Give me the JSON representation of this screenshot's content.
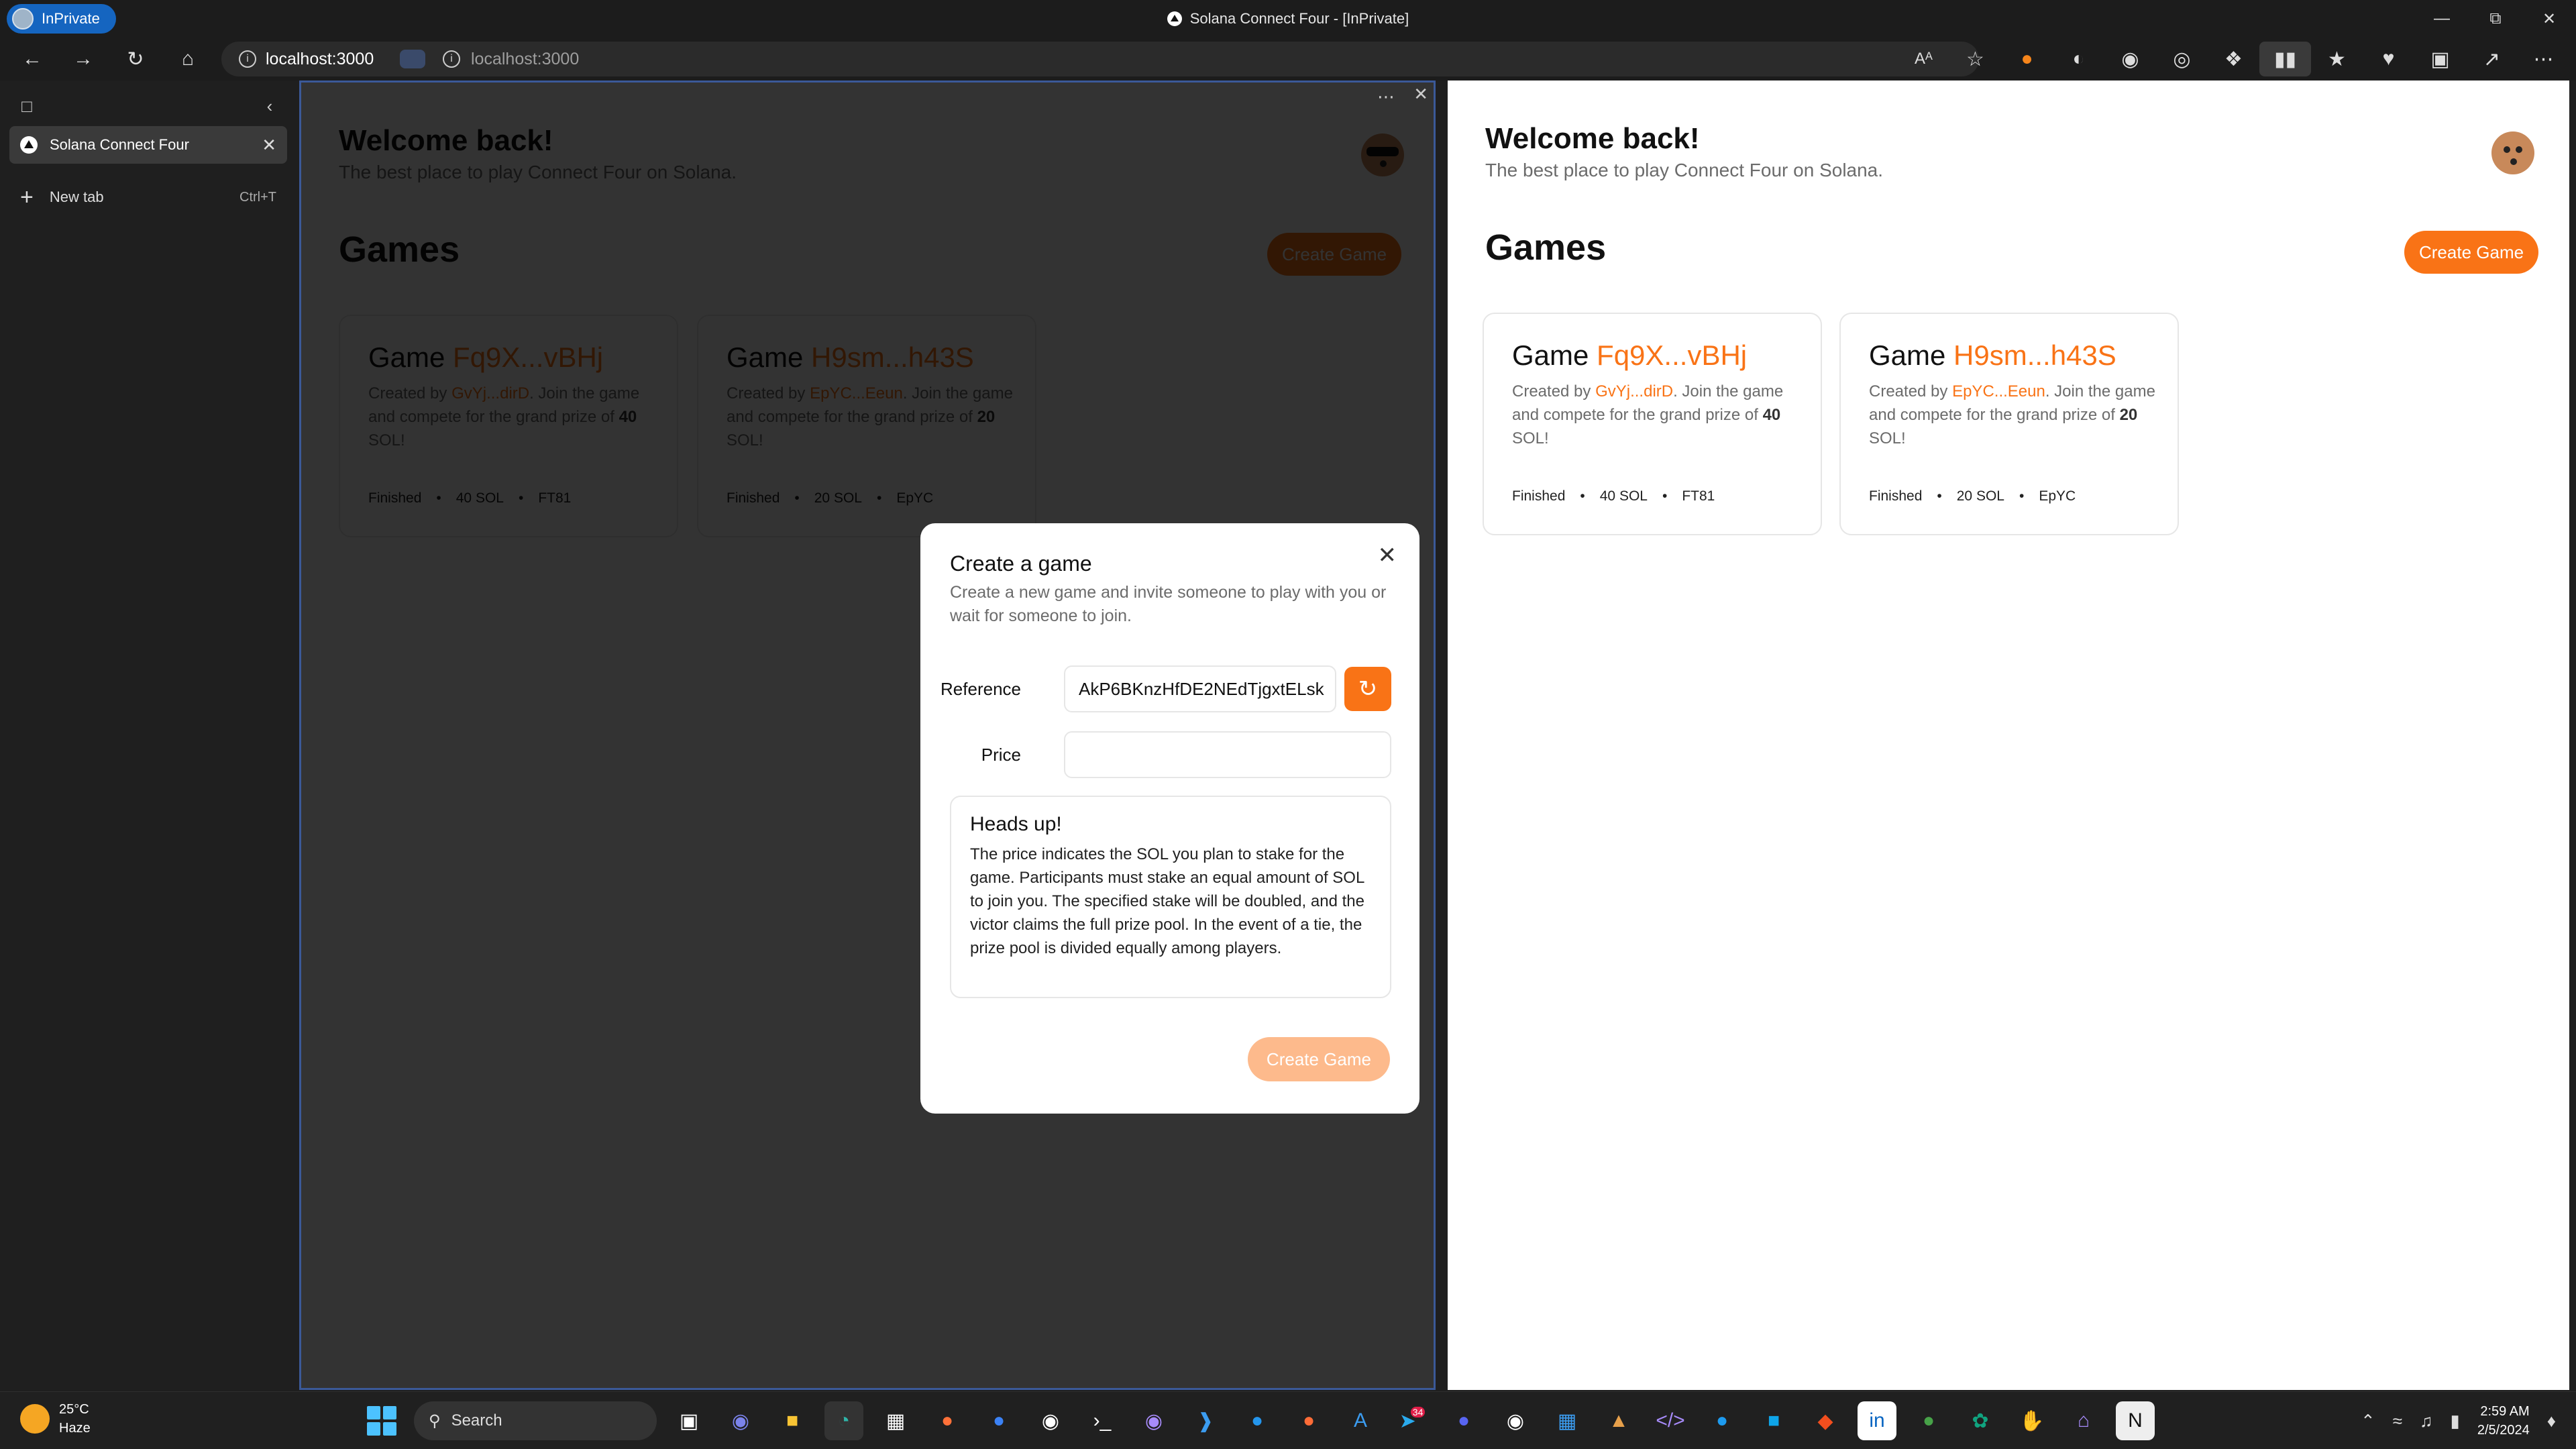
{
  "browser": {
    "profile_label": "InPrivate",
    "window_title": "Solana Connect Four - [InPrivate]",
    "url_primary": "localhost:3000",
    "url_secondary": "localhost:3000",
    "read_aloud_label": "Aᴬ"
  },
  "sidebar": {
    "tabs": [
      {
        "label": "Solana Connect Four"
      }
    ],
    "new_tab_label": "New tab",
    "new_tab_shortcut": "Ctrl+T"
  },
  "app": {
    "welcome": "Welcome back!",
    "subtitle": "The best place to play Connect Four on Solana.",
    "games_heading": "Games",
    "create_button": "Create Game",
    "games": [
      {
        "prefix": "Game",
        "id": "Fq9X...vBHj",
        "created_by_prefix": "Created by",
        "creator": "GvYj...dirD",
        "desc_mid": ". Join the game and compete for the grand prize of",
        "prize": "40",
        "desc_end": "SOL!",
        "status": "Finished",
        "dot": "•",
        "amount": "40 SOL",
        "code": "FT81"
      },
      {
        "prefix": "Game",
        "id": "H9sm...h43S",
        "created_by_prefix": "Created by",
        "creator": "EpYC...Eeun",
        "desc_mid": ". Join the game and compete for the grand prize of",
        "prize": "20",
        "desc_end": "SOL!",
        "status": "Finished",
        "dot": "•",
        "amount": "20 SOL",
        "code": "EpYC"
      }
    ]
  },
  "modal": {
    "title": "Create a game",
    "description": "Create a new game and invite someone to play with you or wait for someone to join.",
    "reference_label": "Reference",
    "reference_value": "AkP6BKnzHfDE2NEdTjgxtELsk",
    "price_label": "Price",
    "price_value": "",
    "heads_up_title": "Heads up!",
    "heads_up_text": "The price indicates the SOL you plan to stake for the game. Participants must stake an equal amount of SOL to join you. The specified stake will be doubled, and the victor claims the full prize pool. In the event of a tie, the prize pool is divided equally among players.",
    "submit_label": "Create Game"
  },
  "taskbar": {
    "temperature": "25°C",
    "weather": "Haze",
    "search_label": "Search",
    "time": "2:59 AM",
    "date": "2/5/2024",
    "badge": "34"
  },
  "colors": {
    "accent": "#f97316",
    "accent_disabled": "#fdba8c",
    "dark_bg": "#1f1f1f"
  }
}
